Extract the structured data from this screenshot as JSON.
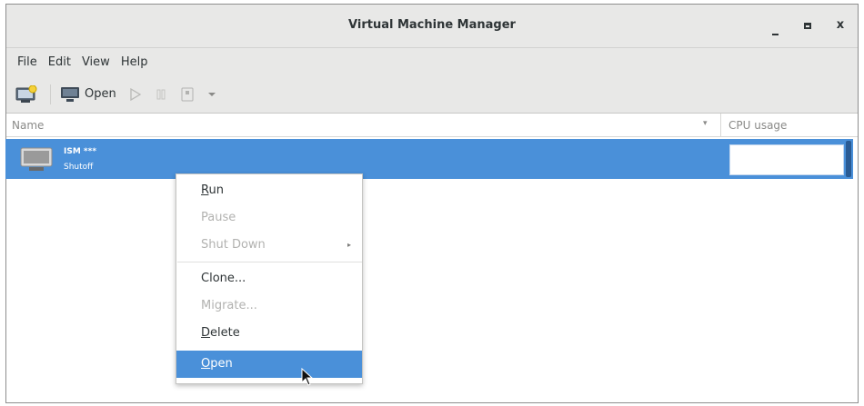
{
  "window": {
    "title": "Virtual Machine Manager",
    "controls": {
      "minimize": "_",
      "maximize": "□",
      "close": "x"
    }
  },
  "menubar": {
    "items": [
      "File",
      "Edit",
      "View",
      "Help"
    ]
  },
  "toolbar": {
    "new_vm_icon": "new-vm-icon",
    "open_label": "Open",
    "run_icon": "play-icon",
    "pause_icon": "pause-icon",
    "shutdown_icon": "shutdown-icon",
    "dropdown_icon": "chevron-down-icon"
  },
  "columns": {
    "name": "Name",
    "sort_indicator": "▾",
    "cpu": "CPU usage"
  },
  "vm": {
    "name": "ISM ***",
    "status": "Shutoff",
    "selected": true
  },
  "context_menu": {
    "items": [
      {
        "label": "Run",
        "mnemonic": "R",
        "enabled": true
      },
      {
        "label": "Pause",
        "enabled": false
      },
      {
        "label": "Shut Down",
        "enabled": false,
        "submenu": true,
        "arrow": "▸"
      },
      {
        "label": "Clone...",
        "enabled": true
      },
      {
        "label": "Migrate...",
        "enabled": false
      },
      {
        "label": "Delete",
        "mnemonic": "D",
        "enabled": true
      },
      {
        "label": "Open",
        "mnemonic": "O",
        "enabled": true,
        "highlighted": true
      }
    ]
  },
  "colors": {
    "selection": "#4a90d9",
    "chrome_bg": "#e8e8e7",
    "disabled_text": "#b2b2b0"
  }
}
